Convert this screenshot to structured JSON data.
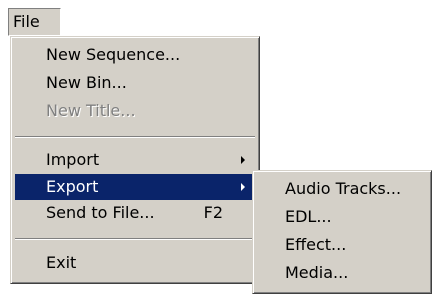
{
  "menubar": {
    "file_label": "File"
  },
  "file_menu": {
    "items": [
      {
        "label": "New Sequence...",
        "enabled": true
      },
      {
        "label": "New Bin...",
        "enabled": true
      },
      {
        "label": "New Title...",
        "enabled": false
      },
      {
        "label": "Import",
        "enabled": true,
        "has_submenu": true
      },
      {
        "label": "Export",
        "enabled": true,
        "has_submenu": true,
        "selected": true
      },
      {
        "label": "Send to File...",
        "enabled": true,
        "shortcut": "F2"
      },
      {
        "label": "Exit",
        "enabled": true
      }
    ]
  },
  "export_submenu": {
    "items": [
      {
        "label": "Audio Tracks..."
      },
      {
        "label": "EDL..."
      },
      {
        "label": "Effect..."
      },
      {
        "label": "Media..."
      }
    ]
  },
  "colors": {
    "menu_bg": "#d4d0c8",
    "highlight_bg": "#0a246a",
    "highlight_text": "#ffffff",
    "disabled_text": "#808080"
  }
}
